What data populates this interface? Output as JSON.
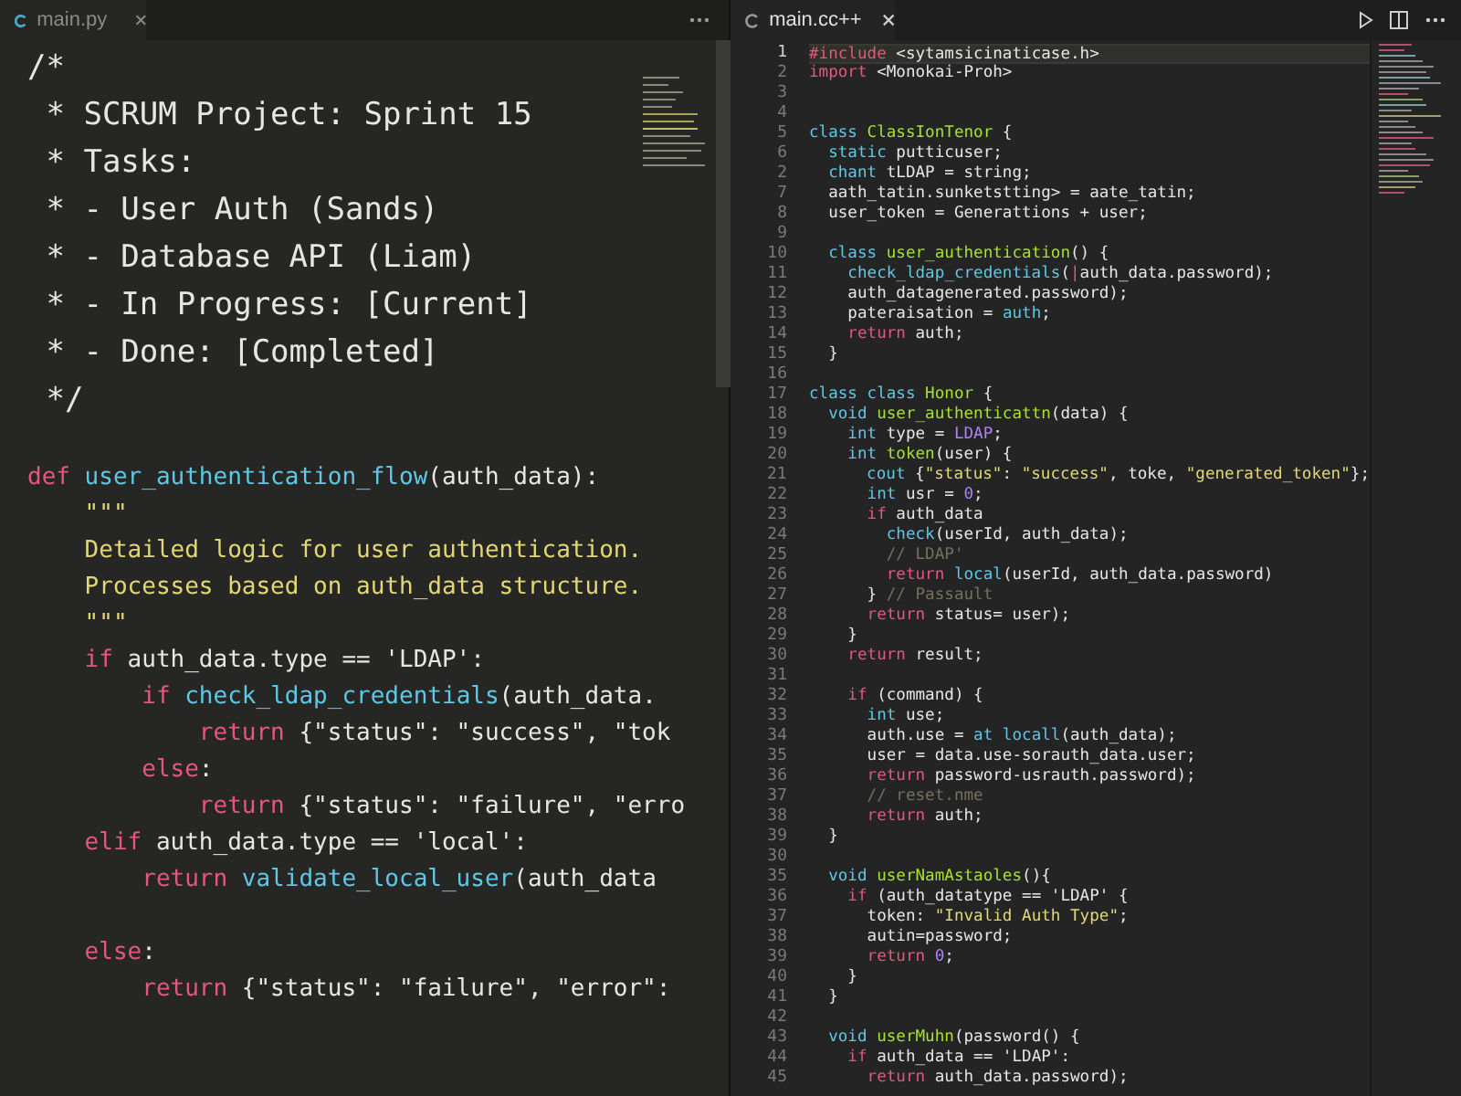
{
  "left_editor": {
    "tab": "main.py",
    "header_comment": [
      "/*",
      " * SCRUM Project: Sprint 15",
      " * Tasks:",
      " * - User Auth (Sands)",
      " * - Database API (Liam)",
      " * - In Progress: [Current]",
      " * - Done: [Completed]",
      " */"
    ],
    "lines": [
      {
        "kind": "blank"
      },
      {
        "kind": "code",
        "code": [
          {
            "text": "def",
            "kind": "control"
          },
          {
            "text": " user_authentication_flow",
            "kind": "function"
          },
          {
            "text": "(auth_data):",
            "kind": "plain"
          }
        ]
      },
      {
        "kind": "code",
        "code": [
          {
            "text": "    \"\"\"",
            "kind": "doc"
          }
        ]
      },
      {
        "kind": "code",
        "code": [
          {
            "text": "    Detailed logic for user authentication.",
            "kind": "doc"
          }
        ]
      },
      {
        "kind": "code",
        "code": [
          {
            "text": "    Processes based on auth_data structure.",
            "kind": "doc"
          }
        ]
      },
      {
        "kind": "code",
        "code": [
          {
            "text": "    \"\"\"",
            "kind": "doc"
          }
        ]
      },
      {
        "kind": "code",
        "code": [
          {
            "text": "    if",
            "kind": "control"
          },
          {
            "text": " auth_data.type == 'LDAP':",
            "kind": "plain"
          }
        ]
      },
      {
        "kind": "code",
        "code": [
          {
            "text": "        if",
            "kind": "control"
          },
          {
            "text": " check_ldap_credentials",
            "kind": "function"
          },
          {
            "text": "(auth_data.",
            "kind": "plain"
          }
        ]
      },
      {
        "kind": "code",
        "code": [
          {
            "text": "            return",
            "kind": "control"
          },
          {
            "text": " {\"status\": \"success\", \"tok",
            "kind": "plain"
          }
        ]
      },
      {
        "kind": "code",
        "code": [
          {
            "text": "        else",
            "kind": "control"
          },
          {
            "text": ":",
            "kind": "plain"
          }
        ]
      },
      {
        "kind": "code",
        "code": [
          {
            "text": "            return",
            "kind": "control"
          },
          {
            "text": " {\"status\": \"failure\", \"erro",
            "kind": "plain"
          }
        ]
      },
      {
        "kind": "code",
        "code": [
          {
            "text": "    elif",
            "kind": "control"
          },
          {
            "text": " auth_data.type == 'local':",
            "kind": "plain"
          }
        ]
      },
      {
        "kind": "code",
        "code": [
          {
            "text": "        return",
            "kind": "control"
          },
          {
            "text": " validate_local_user",
            "kind": "function"
          },
          {
            "text": "(auth_data",
            "kind": "plain"
          }
        ]
      },
      {
        "kind": "blank"
      },
      {
        "kind": "code",
        "code": [
          {
            "text": "    else",
            "kind": "control"
          },
          {
            "text": ":",
            "kind": "plain"
          }
        ]
      },
      {
        "kind": "code",
        "code": [
          {
            "text": "        return",
            "kind": "control"
          },
          {
            "text": " {\"status\": \"failure\", \"error\":",
            "kind": "plain"
          }
        ]
      }
    ]
  },
  "right_editor": {
    "tab": "main.cc++",
    "lines": [
      {
        "number": "1",
        "current": true,
        "kind": "code",
        "code": [
          {
            "text": "#include",
            "kind": "control"
          },
          {
            "text": " <sytamsicinaticase.h>",
            "kind": "plain"
          }
        ]
      },
      {
        "number": "2",
        "current": false,
        "kind": "code",
        "code": [
          {
            "text": "import",
            "kind": "control"
          },
          {
            "text": " <Monokai-Proh>",
            "kind": "plain"
          }
        ]
      },
      {
        "number": "3",
        "current": false,
        "kind": "blank"
      },
      {
        "number": "4",
        "current": false,
        "kind": "blank"
      },
      {
        "number": "5",
        "current": false,
        "kind": "code",
        "code": [
          {
            "text": "class",
            "kind": "keyword"
          },
          {
            "text": " ClassIonTenor",
            "kind": "name"
          },
          {
            "text": " {",
            "kind": "plain"
          }
        ]
      },
      {
        "number": "6",
        "current": false,
        "kind": "code",
        "code": [
          {
            "text": "  static",
            "kind": "keyword"
          },
          {
            "text": " putticuser;",
            "kind": "plain"
          }
        ]
      },
      {
        "number": "2",
        "current": false,
        "kind": "code",
        "code": [
          {
            "text": "  chant",
            "kind": "keyword"
          },
          {
            "text": " tLDAP = string;",
            "kind": "plain"
          }
        ]
      },
      {
        "number": "7",
        "current": false,
        "kind": "code",
        "code": [
          {
            "text": "  aath_tatin.sunketstting> = aate_tatin;",
            "kind": "plain"
          }
        ]
      },
      {
        "number": "8",
        "current": false,
        "kind": "code",
        "code": [
          {
            "text": "  user_token = Generattions + user;",
            "kind": "plain"
          }
        ]
      },
      {
        "number": "9",
        "current": false,
        "kind": "blank"
      },
      {
        "number": "10",
        "current": false,
        "kind": "code",
        "code": [
          {
            "text": "  class",
            "kind": "keyword"
          },
          {
            "text": " user_authentication",
            "kind": "name"
          },
          {
            "text": "() {",
            "kind": "plain"
          }
        ]
      },
      {
        "number": "11",
        "current": false,
        "kind": "code",
        "code": [
          {
            "text": "    check_ldap_credentials",
            "kind": "keyword"
          },
          {
            "text": "(",
            "kind": "plain"
          },
          {
            "text": "|",
            "kind": "control"
          },
          {
            "text": "auth_data.password);",
            "kind": "plain"
          }
        ]
      },
      {
        "number": "12",
        "current": false,
        "kind": "code",
        "code": [
          {
            "text": "    auth_datagenerated.password);",
            "kind": "plain"
          }
        ]
      },
      {
        "number": "13",
        "current": false,
        "kind": "code",
        "code": [
          {
            "text": "    pateraisation = ",
            "kind": "plain"
          },
          {
            "text": "auth",
            "kind": "keyword"
          },
          {
            "text": ";",
            "kind": "plain"
          }
        ]
      },
      {
        "number": "14",
        "current": false,
        "kind": "code",
        "code": [
          {
            "text": "    return",
            "kind": "control"
          },
          {
            "text": " auth;",
            "kind": "plain"
          }
        ]
      },
      {
        "number": "15",
        "current": false,
        "kind": "code",
        "code": [
          {
            "text": "  }",
            "kind": "plain"
          }
        ]
      },
      {
        "number": "16",
        "current": false,
        "kind": "blank"
      },
      {
        "number": "17",
        "current": false,
        "kind": "code",
        "code": [
          {
            "text": "class class",
            "kind": "keyword"
          },
          {
            "text": " Honor",
            "kind": "name"
          },
          {
            "text": " {",
            "kind": "plain"
          }
        ]
      },
      {
        "number": "18",
        "current": false,
        "kind": "code",
        "code": [
          {
            "text": "  void",
            "kind": "keyword"
          },
          {
            "text": " user_authenticattn",
            "kind": "name"
          },
          {
            "text": "(data) {",
            "kind": "plain"
          }
        ]
      },
      {
        "number": "19",
        "current": false,
        "kind": "code",
        "code": [
          {
            "text": "    int",
            "kind": "keyword"
          },
          {
            "text": " type = ",
            "kind": "plain"
          },
          {
            "text": "LDAP",
            "kind": "number"
          },
          {
            "text": ";",
            "kind": "plain"
          }
        ]
      },
      {
        "number": "20",
        "current": false,
        "kind": "code",
        "code": [
          {
            "text": "    int",
            "kind": "keyword"
          },
          {
            "text": " token",
            "kind": "name"
          },
          {
            "text": "(user) {",
            "kind": "plain"
          }
        ]
      },
      {
        "number": "21",
        "current": false,
        "kind": "code",
        "code": [
          {
            "text": "      cout",
            "kind": "keyword"
          },
          {
            "text": " {",
            "kind": "plain"
          },
          {
            "text": "\"status\"",
            "kind": "string"
          },
          {
            "text": ": ",
            "kind": "plain"
          },
          {
            "text": "\"success\"",
            "kind": "string"
          },
          {
            "text": ", toke, ",
            "kind": "plain"
          },
          {
            "text": "\"generated_token\"",
            "kind": "string"
          },
          {
            "text": "};",
            "kind": "plain"
          }
        ]
      },
      {
        "number": "22",
        "current": false,
        "kind": "code",
        "code": [
          {
            "text": "      int",
            "kind": "keyword"
          },
          {
            "text": " usr = ",
            "kind": "plain"
          },
          {
            "text": "0",
            "kind": "number"
          },
          {
            "text": ";",
            "kind": "plain"
          }
        ]
      },
      {
        "number": "23",
        "current": false,
        "kind": "code",
        "code": [
          {
            "text": "      if",
            "kind": "control"
          },
          {
            "text": " auth_data",
            "kind": "plain"
          }
        ]
      },
      {
        "number": "24",
        "current": false,
        "kind": "code",
        "code": [
          {
            "text": "        check",
            "kind": "keyword"
          },
          {
            "text": "(userId, auth_data);",
            "kind": "plain"
          }
        ]
      },
      {
        "number": "25",
        "current": false,
        "kind": "code",
        "code": [
          {
            "text": "        // LDAP'",
            "kind": "comment"
          }
        ]
      },
      {
        "number": "26",
        "current": false,
        "kind": "code",
        "code": [
          {
            "text": "        return",
            "kind": "control"
          },
          {
            "text": " local",
            "kind": "keyword"
          },
          {
            "text": "(userId, auth_data.password)",
            "kind": "plain"
          }
        ]
      },
      {
        "number": "27",
        "current": false,
        "kind": "code",
        "code": [
          {
            "text": "      }",
            "kind": "plain"
          },
          {
            "text": " // Passault",
            "kind": "comment"
          }
        ]
      },
      {
        "number": "28",
        "current": false,
        "kind": "code",
        "code": [
          {
            "text": "      return",
            "kind": "control"
          },
          {
            "text": " status= user);",
            "kind": "plain"
          }
        ]
      },
      {
        "number": "29",
        "current": false,
        "kind": "code",
        "code": [
          {
            "text": "    }",
            "kind": "plain"
          }
        ]
      },
      {
        "number": "30",
        "current": false,
        "kind": "code",
        "code": [
          {
            "text": "    return",
            "kind": "control"
          },
          {
            "text": " result;",
            "kind": "plain"
          }
        ]
      },
      {
        "number": "31",
        "current": false,
        "kind": "blank"
      },
      {
        "number": "32",
        "current": false,
        "kind": "code",
        "code": [
          {
            "text": "    if",
            "kind": "control"
          },
          {
            "text": " (command) {",
            "kind": "plain"
          }
        ]
      },
      {
        "number": "33",
        "current": false,
        "kind": "code",
        "code": [
          {
            "text": "      int",
            "kind": "keyword"
          },
          {
            "text": " use;",
            "kind": "plain"
          }
        ]
      },
      {
        "number": "34",
        "current": false,
        "kind": "code",
        "code": [
          {
            "text": "      auth.use = ",
            "kind": "plain"
          },
          {
            "text": "at locall",
            "kind": "keyword"
          },
          {
            "text": "(auth_data);",
            "kind": "plain"
          }
        ]
      },
      {
        "number": "35",
        "current": false,
        "kind": "code",
        "code": [
          {
            "text": "      user = data.use-sorauth_data.user;",
            "kind": "plain"
          }
        ]
      },
      {
        "number": "36",
        "current": false,
        "kind": "code",
        "code": [
          {
            "text": "      return",
            "kind": "control"
          },
          {
            "text": " password-usrauth.password);",
            "kind": "plain"
          }
        ]
      },
      {
        "number": "37",
        "current": false,
        "kind": "code",
        "code": [
          {
            "text": "      // reset.nme",
            "kind": "comment"
          }
        ]
      },
      {
        "number": "38",
        "current": false,
        "kind": "code",
        "code": [
          {
            "text": "      return",
            "kind": "control"
          },
          {
            "text": " auth;",
            "kind": "plain"
          }
        ]
      },
      {
        "number": "39",
        "current": false,
        "kind": "code",
        "code": [
          {
            "text": "  }",
            "kind": "plain"
          }
        ]
      },
      {
        "number": "30",
        "current": false,
        "kind": "blank"
      },
      {
        "number": "35",
        "current": false,
        "kind": "code",
        "code": [
          {
            "text": "  void",
            "kind": "keyword"
          },
          {
            "text": " userNamAstaoles",
            "kind": "name"
          },
          {
            "text": "(){",
            "kind": "plain"
          }
        ]
      },
      {
        "number": "36",
        "current": false,
        "kind": "code",
        "code": [
          {
            "text": "    if",
            "kind": "control"
          },
          {
            "text": " (auth_datatype == 'LDAP' {",
            "kind": "plain"
          }
        ]
      },
      {
        "number": "37",
        "current": false,
        "kind": "code",
        "code": [
          {
            "text": "      token: ",
            "kind": "plain"
          },
          {
            "text": "\"Invalid Auth Type\"",
            "kind": "string"
          },
          {
            "text": ";",
            "kind": "plain"
          }
        ]
      },
      {
        "number": "38",
        "current": false,
        "kind": "code",
        "code": [
          {
            "text": "      autin=password;",
            "kind": "plain"
          }
        ]
      },
      {
        "number": "39",
        "current": false,
        "kind": "code",
        "code": [
          {
            "text": "      return",
            "kind": "control"
          },
          {
            "text": " 0",
            "kind": "number"
          },
          {
            "text": ";",
            "kind": "plain"
          }
        ]
      },
      {
        "number": "40",
        "current": false,
        "kind": "code",
        "code": [
          {
            "text": "    }",
            "kind": "plain"
          }
        ]
      },
      {
        "number": "41",
        "current": false,
        "kind": "code",
        "code": [
          {
            "text": "  }",
            "kind": "plain"
          }
        ]
      },
      {
        "number": "42",
        "current": false,
        "kind": "blank"
      },
      {
        "number": "43",
        "current": false,
        "kind": "code",
        "code": [
          {
            "text": "  void",
            "kind": "keyword"
          },
          {
            "text": " userMuhn",
            "kind": "name"
          },
          {
            "text": "(password() {",
            "kind": "plain"
          }
        ]
      },
      {
        "number": "44",
        "current": false,
        "kind": "code",
        "code": [
          {
            "text": "    if",
            "kind": "control"
          },
          {
            "text": " auth_data == 'LDAP':",
            "kind": "plain"
          }
        ]
      },
      {
        "number": "45",
        "current": false,
        "kind": "code",
        "code": [
          {
            "text": "      return",
            "kind": "control"
          },
          {
            "text": " auth_data.password);",
            "kind": "plain"
          }
        ]
      }
    ]
  }
}
